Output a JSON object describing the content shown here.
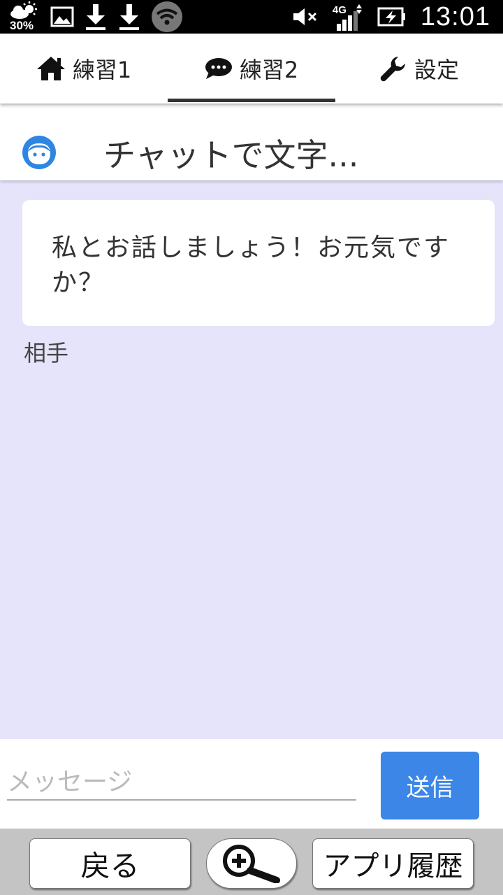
{
  "status_bar": {
    "battery_percent": "30%",
    "time": "13:01",
    "network": "4G",
    "icons": [
      "weather-icon",
      "image-icon",
      "download-icon",
      "download-icon",
      "wifi-icon",
      "mute-icon",
      "signal-icon",
      "battery-charging-icon"
    ]
  },
  "tabs": [
    {
      "label": "練習1",
      "icon": "home-icon",
      "selected": false
    },
    {
      "label": "練習2",
      "icon": "chat-bubble-icon",
      "selected": true
    },
    {
      "label": "設定",
      "icon": "wrench-icon",
      "selected": false
    }
  ],
  "chat": {
    "title": "チャットで文字...",
    "avatar_icon": "face-icon",
    "messages": [
      {
        "text": "私とお話しましょう！お元気ですか？",
        "sender": "相手"
      }
    ]
  },
  "input": {
    "placeholder": "メッセージ",
    "value": "",
    "send_label": "送信"
  },
  "bottom_nav": {
    "back_label": "戻る",
    "zoom_icon": "zoom-in-icon",
    "history_label": "アプリ履歴"
  },
  "colors": {
    "chat_background": "#e6e4fa",
    "send_button": "#3b86e6",
    "avatar": "#2f86e2"
  }
}
